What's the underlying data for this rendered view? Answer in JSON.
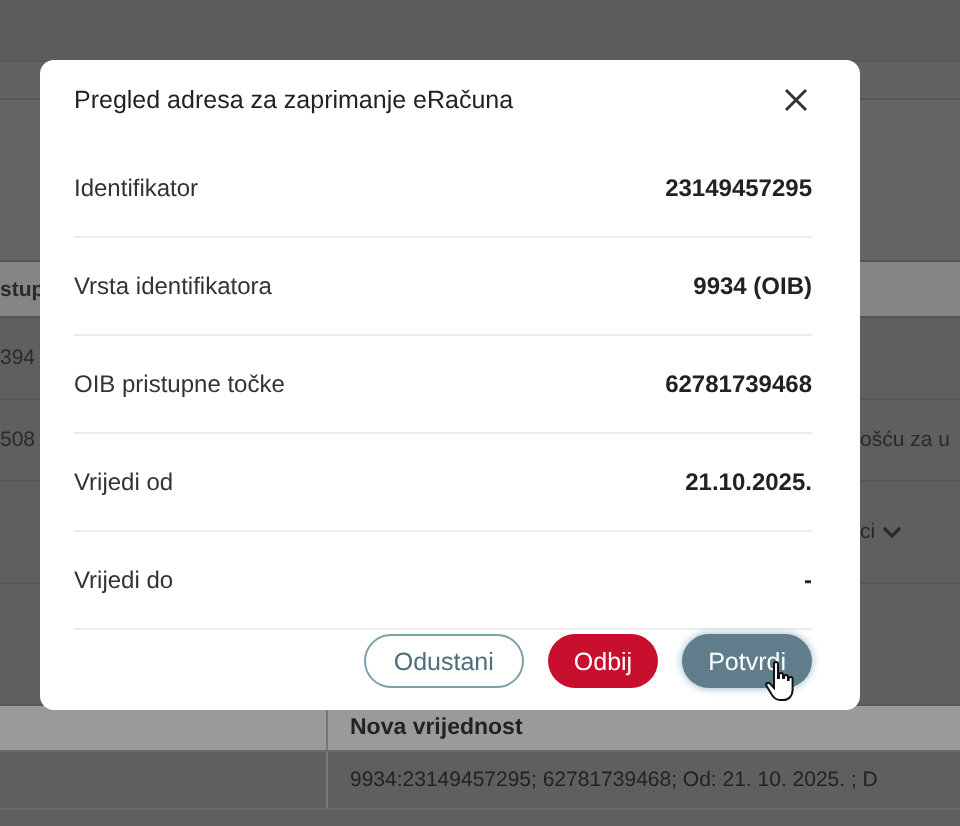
{
  "background": {
    "left_column": [
      "stup",
      "394",
      "508"
    ],
    "right_column": [
      "ošću za u",
      "ci"
    ],
    "table": {
      "header": "Nova vrijednost",
      "row": "9934:23149457295; 62781739468; Od: 21. 10. 2025. ; D"
    }
  },
  "dialog": {
    "title": "Pregled adresa za zaprimanje eRačuna",
    "fields": [
      {
        "label": "Identifikator",
        "value": "23149457295"
      },
      {
        "label": "Vrsta identifikatora",
        "value": "9934 (OIB)"
      },
      {
        "label": "OIB pristupne točke",
        "value": "62781739468"
      },
      {
        "label": "Vrijedi od",
        "value": "21.10.2025."
      },
      {
        "label": "Vrijedi do",
        "value": "-"
      }
    ],
    "buttons": [
      {
        "label": "Odustani",
        "kind": "outline"
      },
      {
        "label": "Odbij",
        "kind": "danger"
      },
      {
        "label": "Potvrdi",
        "kind": "primary"
      }
    ]
  }
}
